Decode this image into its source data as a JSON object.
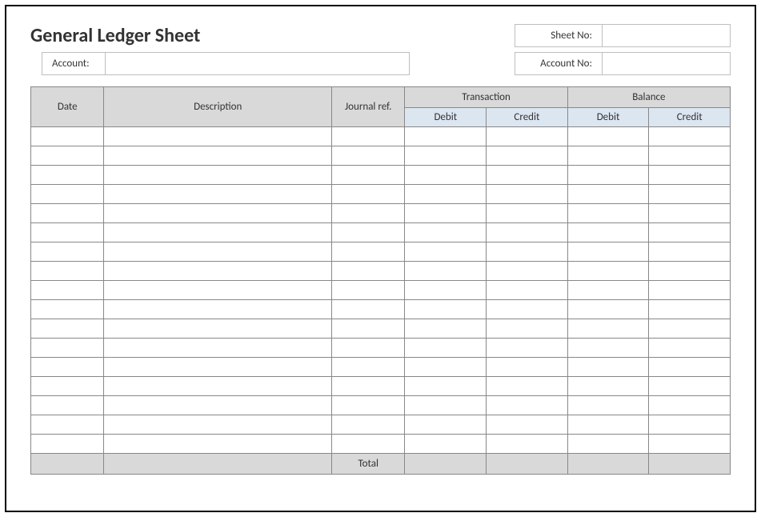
{
  "title": "General Ledger Sheet",
  "meta": {
    "sheet_no_label": "Sheet No:",
    "sheet_no_value": "",
    "account_no_label": "Account No:",
    "account_no_value": "",
    "account_label": "Account:",
    "account_value": ""
  },
  "table": {
    "headers": {
      "date": "Date",
      "description": "Description",
      "journal_ref": "Journal ref.",
      "transaction": "Transaction",
      "balance": "Balance",
      "debit": "Debit",
      "credit": "Credit"
    },
    "rows": [
      {
        "date": "",
        "description": "",
        "journal_ref": "",
        "trans_debit": "",
        "trans_credit": "",
        "bal_debit": "",
        "bal_credit": ""
      },
      {
        "date": "",
        "description": "",
        "journal_ref": "",
        "trans_debit": "",
        "trans_credit": "",
        "bal_debit": "",
        "bal_credit": ""
      },
      {
        "date": "",
        "description": "",
        "journal_ref": "",
        "trans_debit": "",
        "trans_credit": "",
        "bal_debit": "",
        "bal_credit": ""
      },
      {
        "date": "",
        "description": "",
        "journal_ref": "",
        "trans_debit": "",
        "trans_credit": "",
        "bal_debit": "",
        "bal_credit": ""
      },
      {
        "date": "",
        "description": "",
        "journal_ref": "",
        "trans_debit": "",
        "trans_credit": "",
        "bal_debit": "",
        "bal_credit": ""
      },
      {
        "date": "",
        "description": "",
        "journal_ref": "",
        "trans_debit": "",
        "trans_credit": "",
        "bal_debit": "",
        "bal_credit": ""
      },
      {
        "date": "",
        "description": "",
        "journal_ref": "",
        "trans_debit": "",
        "trans_credit": "",
        "bal_debit": "",
        "bal_credit": ""
      },
      {
        "date": "",
        "description": "",
        "journal_ref": "",
        "trans_debit": "",
        "trans_credit": "",
        "bal_debit": "",
        "bal_credit": ""
      },
      {
        "date": "",
        "description": "",
        "journal_ref": "",
        "trans_debit": "",
        "trans_credit": "",
        "bal_debit": "",
        "bal_credit": ""
      },
      {
        "date": "",
        "description": "",
        "journal_ref": "",
        "trans_debit": "",
        "trans_credit": "",
        "bal_debit": "",
        "bal_credit": ""
      },
      {
        "date": "",
        "description": "",
        "journal_ref": "",
        "trans_debit": "",
        "trans_credit": "",
        "bal_debit": "",
        "bal_credit": ""
      },
      {
        "date": "",
        "description": "",
        "journal_ref": "",
        "trans_debit": "",
        "trans_credit": "",
        "bal_debit": "",
        "bal_credit": ""
      },
      {
        "date": "",
        "description": "",
        "journal_ref": "",
        "trans_debit": "",
        "trans_credit": "",
        "bal_debit": "",
        "bal_credit": ""
      },
      {
        "date": "",
        "description": "",
        "journal_ref": "",
        "trans_debit": "",
        "trans_credit": "",
        "bal_debit": "",
        "bal_credit": ""
      },
      {
        "date": "",
        "description": "",
        "journal_ref": "",
        "trans_debit": "",
        "trans_credit": "",
        "bal_debit": "",
        "bal_credit": ""
      },
      {
        "date": "",
        "description": "",
        "journal_ref": "",
        "trans_debit": "",
        "trans_credit": "",
        "bal_debit": "",
        "bal_credit": ""
      },
      {
        "date": "",
        "description": "",
        "journal_ref": "",
        "trans_debit": "",
        "trans_credit": "",
        "bal_debit": "",
        "bal_credit": ""
      }
    ],
    "total_label": "Total",
    "totals": {
      "trans_debit": "",
      "trans_credit": "",
      "bal_debit": "",
      "bal_credit": ""
    }
  }
}
